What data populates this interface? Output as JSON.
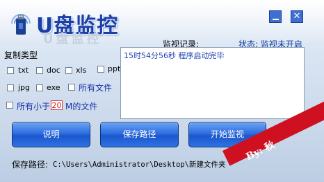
{
  "app": {
    "title": "U盘监控",
    "title_echo": "U盘监控",
    "minimize_label": "",
    "close_label": "✕"
  },
  "copy_types": {
    "heading": "复制类型",
    "options": [
      {
        "label": "txt",
        "checked": false
      },
      {
        "label": "doc",
        "checked": false
      },
      {
        "label": "xls",
        "checked": false
      },
      {
        "label": "ppt",
        "checked": false
      },
      {
        "label": "jpg",
        "checked": false
      },
      {
        "label": "exe",
        "checked": false
      },
      {
        "label": "所有文件",
        "checked": false
      }
    ],
    "size_filter": {
      "checked": false,
      "prefix": "所有小于",
      "value": "20",
      "suffix": "M的文件"
    }
  },
  "monitor": {
    "log_label": "监视记录:",
    "status_text": "状态: 监视未开启",
    "log_entries": [
      "15时54分56秒  程序启动完毕"
    ]
  },
  "buttons": {
    "help": "说明",
    "save_path": "保存路径",
    "start": "开始监视"
  },
  "save_path": {
    "label": "保存路径:",
    "value": "C:\\Users\\Administrator\\Desktop\\新建文件夹"
  },
  "signature": "By: 秋",
  "colors": {
    "accent": "#1a3fa8",
    "button": "#2e6ee0",
    "signature_band": "#cf1020",
    "size_input_text": "#d02020"
  }
}
